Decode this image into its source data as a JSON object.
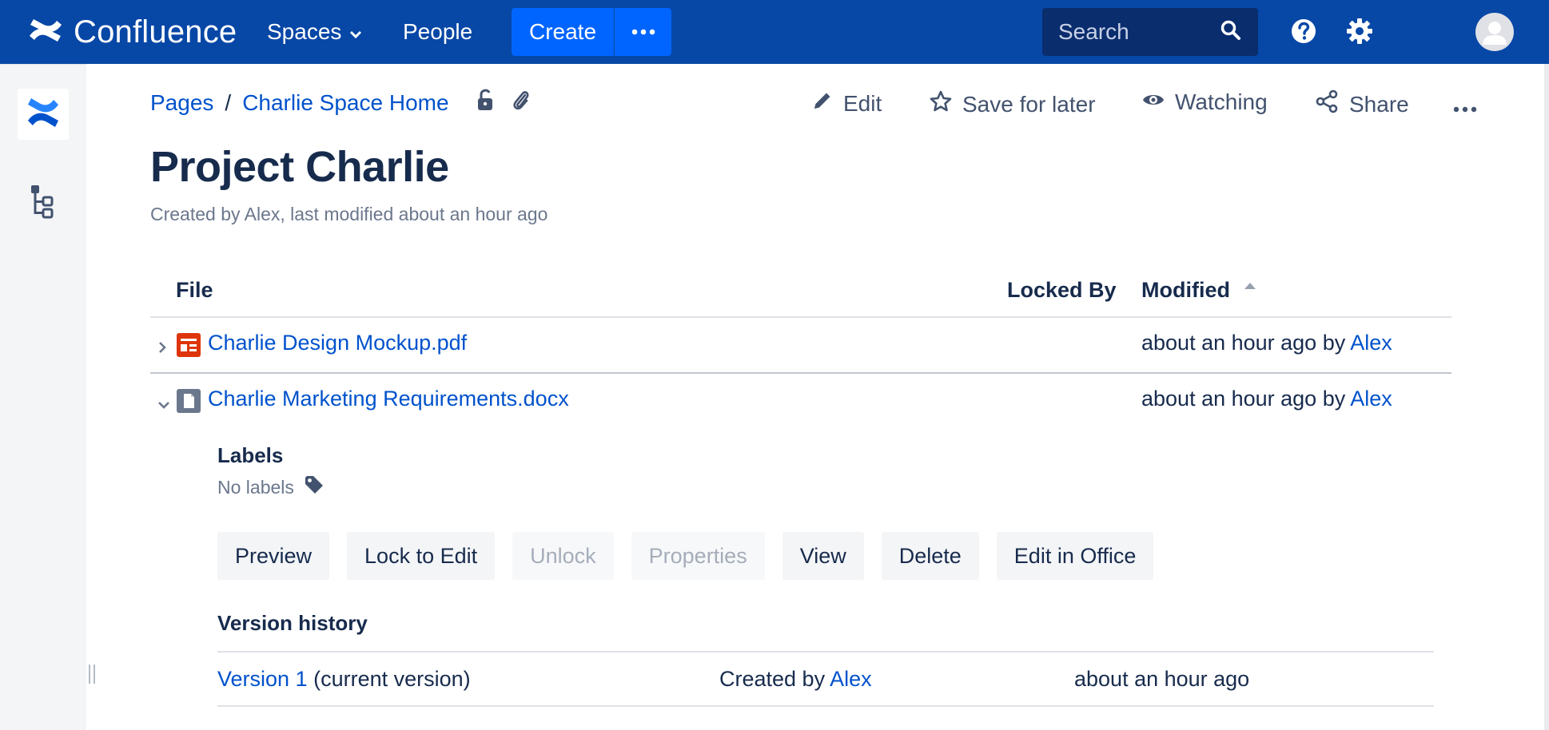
{
  "topnav": {
    "brand": "Confluence",
    "spaces": "Spaces",
    "people": "People",
    "create": "Create",
    "search_placeholder": "Search"
  },
  "breadcrumb": {
    "pages": "Pages",
    "separator": "/",
    "space_home": "Charlie Space Home"
  },
  "actions": {
    "edit": "Edit",
    "save": "Save for later",
    "watch": "Watching",
    "share": "Share"
  },
  "page": {
    "title": "Project Charlie",
    "meta": "Created by Alex, last modified about an hour ago"
  },
  "table": {
    "headers": {
      "file": "File",
      "locked_by": "Locked By",
      "modified": "Modified"
    },
    "rows": [
      {
        "name": "Charlie Design Mockup.pdf",
        "modified": "about an hour ago by",
        "author": "Alex",
        "icon": "pdf-file-icon",
        "expanded": false
      },
      {
        "name": "Charlie Marketing Requirements.docx",
        "modified": "about an hour ago by",
        "author": "Alex",
        "icon": "document-file-icon",
        "expanded": true
      }
    ]
  },
  "details": {
    "labels_heading": "Labels",
    "labels_value": "No labels",
    "buttons": {
      "preview": "Preview",
      "lock": "Lock to Edit",
      "unlock": "Unlock",
      "properties": "Properties",
      "view": "View",
      "delete": "Delete",
      "edit_office": "Edit in Office"
    },
    "version_heading": "Version history",
    "version": {
      "link": "Version 1",
      "note": "(current version)",
      "created_prefix": "Created by",
      "author": "Alex",
      "when": "about an hour ago"
    }
  },
  "colors": {
    "nav_bg": "#0747a6",
    "create_bg": "#0065ff",
    "link": "#0052cc",
    "text": "#172b4d",
    "muted": "#6b778c",
    "pdf_red": "#de350b"
  }
}
